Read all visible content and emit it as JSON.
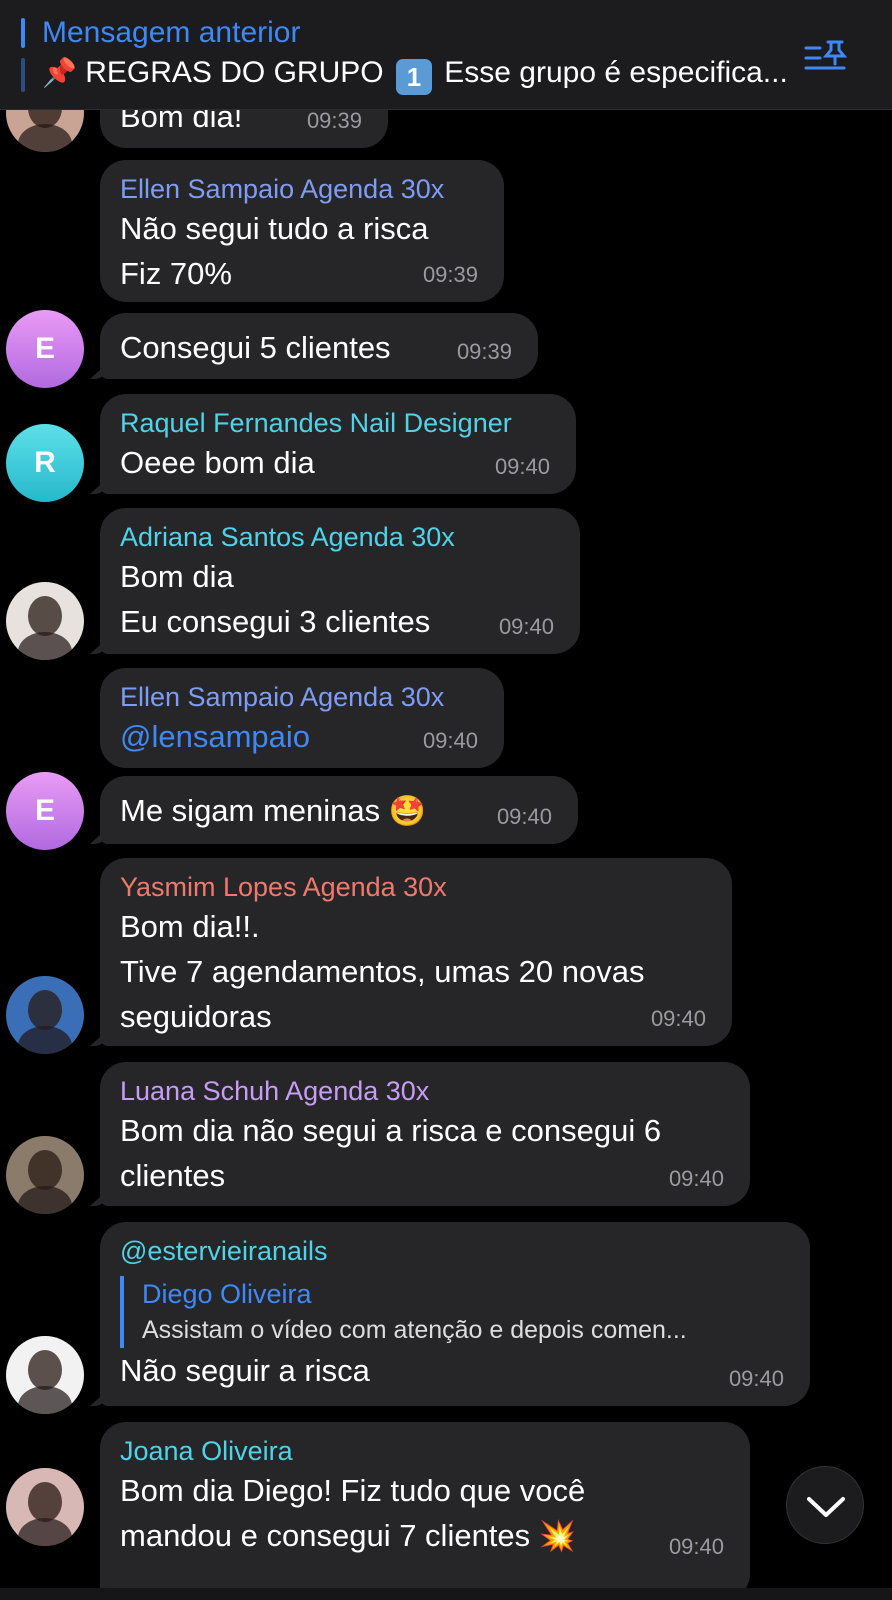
{
  "pinned": {
    "title": "Mensagem anterior",
    "pin_emoji": "📌",
    "text_before": "REGRAS DO GRUPO",
    "keycap": "1",
    "text_after": "Esse grupo é especifica..."
  },
  "colors": {
    "background": "#000000",
    "bubble": "#262628",
    "accent_blue": "#3e88f7",
    "name_violet": "#7f9cf5",
    "name_cyan": "#4fd3e8",
    "name_salmon": "#f0796d",
    "name_purple": "#c69cf5",
    "timestamp": "#9a9aa0"
  },
  "messages": [
    {
      "text": "Bom dia!",
      "time": "09:39"
    },
    {
      "sender": "Ellen Sampaio Agenda 30x",
      "lines": [
        "Não segui tudo a risca",
        "Fiz 70%"
      ],
      "time": "09:39"
    },
    {
      "avatar_initial": "E",
      "text": "Consegui 5 clientes",
      "time": "09:39"
    },
    {
      "sender": "Raquel Fernandes Nail Designer",
      "avatar_initial": "R",
      "text": "Oeee bom dia",
      "time": "09:40"
    },
    {
      "sender": "Adriana Santos Agenda 30x",
      "lines": [
        "Bom dia",
        "Eu consegui 3 clientes"
      ],
      "time": "09:40"
    },
    {
      "sender": "Ellen Sampaio Agenda 30x",
      "text": "@lensampaio",
      "time": "09:40"
    },
    {
      "avatar_initial": "E",
      "text": "Me sigam meninas",
      "emoji": "🤩",
      "time": "09:40"
    },
    {
      "sender": "Yasmim Lopes Agenda 30x",
      "lines": [
        "Bom dia!!.",
        "Tive 7 agendamentos, umas 20 novas",
        "seguidoras"
      ],
      "time": "09:40"
    },
    {
      "sender": "Luana Schuh Agenda 30x",
      "lines": [
        "Bom dia não segui a risca e consegui 6",
        "clientes"
      ],
      "time": "09:40"
    },
    {
      "sender": "@estervieiranails",
      "reply_name": "Diego Oliveira",
      "reply_text": "Assistam o vídeo com atenção e depois comen...",
      "text": "Não seguir a risca",
      "time": "09:40"
    },
    {
      "sender": "Joana Oliveira",
      "lines": [
        "Bom dia Diego! Fiz tudo que você",
        "mandou e consegui 7 clientes"
      ],
      "emoji": "💥",
      "time": "09:40"
    }
  ]
}
